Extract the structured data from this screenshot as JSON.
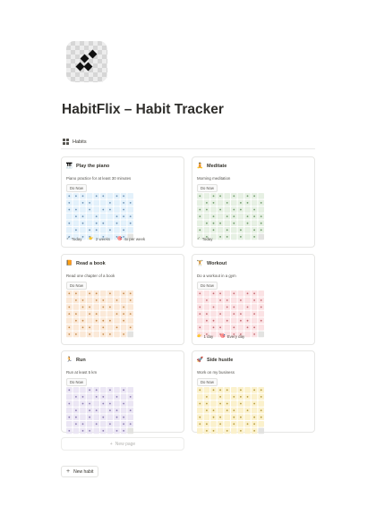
{
  "page": {
    "title": "HabitFlix – Habit Tracker",
    "view_label": "Habits",
    "icon": "checkered-diamond-logo"
  },
  "cards": [
    {
      "name": "Play the piano",
      "icon": "piano-icon",
      "emoji": "🎹",
      "description": "Piano practice for at least 30 minutes",
      "status": "Do Now",
      "color": "#e3f1fb",
      "meta": [
        {
          "icon": "check-icon",
          "emoji": "✓",
          "label": "Today"
        },
        {
          "icon": "streak-icon",
          "emoji": "👉",
          "label": "2 weeks"
        },
        {
          "icon": "frequency-icon",
          "emoji": "🎯",
          "label": "4x per week"
        }
      ],
      "grid": [
        "1110110110",
        "1011001011",
        "1101011010",
        "0110100111",
        "1010110101",
        "0101101010",
        "1011010110"
      ]
    },
    {
      "name": "Meditate",
      "icon": "meditate-icon",
      "emoji": "🧘",
      "description": "Morning meditation",
      "status": "Do Now",
      "color": "#e6f0e3",
      "meta": [
        {
          "icon": "check-icon",
          "emoji": "✓",
          "label": "Today"
        }
      ],
      "grid": [
        "1011010110",
        "0110101101",
        "1101011010",
        "1010110111",
        "0111010101",
        "1010101011",
        "0101101010"
      ]
    },
    {
      "name": "Read a book",
      "icon": "book-icon",
      "emoji": "📙",
      "description": "Read one chapter of a book",
      "status": "Do Now",
      "color": "#fbe9d8",
      "meta": [],
      "grid": [
        "1101101011",
        "0110110101",
        "1011011010",
        "1101100111",
        "0110111010",
        "1011010101",
        "1101011011"
      ]
    },
    {
      "name": "Workout",
      "icon": "dumbbell-icon",
      "emoji": "🏋",
      "description": "Do a workout in a gym",
      "status": "Do Now",
      "color": "#fbe2e4",
      "meta": [
        {
          "icon": "streak-icon",
          "emoji": "👉",
          "label": "1 day"
        },
        {
          "icon": "frequency-icon",
          "emoji": "🎯",
          "label": "Every day"
        }
      ],
      "grid": [
        "1011010110",
        "0101101011",
        "1010110101",
        "1101011010",
        "0110101101",
        "1011010110",
        "0101011010"
      ]
    },
    {
      "name": "Run",
      "icon": "runner-icon",
      "emoji": "🏃",
      "description": "Run at least 5 km",
      "status": "Do Now",
      "color": "#ebe6f4",
      "meta": [],
      "grid": [
        "1001101010",
        "0110110101",
        "1011011010",
        "0101101101",
        "1101010110",
        "0110101011",
        "1011010110"
      ]
    },
    {
      "name": "Side hustle",
      "icon": "rocket-icon",
      "emoji": "🚀",
      "description": "Work on my business",
      "status": "Do Now",
      "color": "#fbf1cc",
      "meta": [],
      "grid": [
        "1011101011",
        "0101011101",
        "1101101010",
        "0110110101",
        "1011011011",
        "1101010110",
        "0110101011"
      ]
    }
  ],
  "new_page_label": "New page",
  "new_habit_label": "New habit"
}
